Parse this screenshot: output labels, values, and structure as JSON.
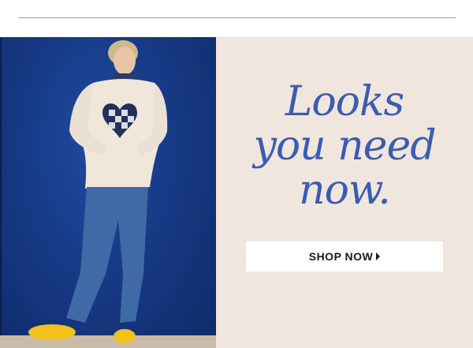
{
  "promo": {
    "headline": [
      "Looks",
      "you need",
      "now."
    ],
    "cta_label": "SHOP NOW"
  },
  "colors": {
    "headline": "#3a5cb3",
    "panel_bg": "#f1e6de",
    "photo_bg": "#173a86",
    "button_bg": "#ffffff"
  },
  "icons": {
    "cta_arrow": "caret-right-icon"
  }
}
